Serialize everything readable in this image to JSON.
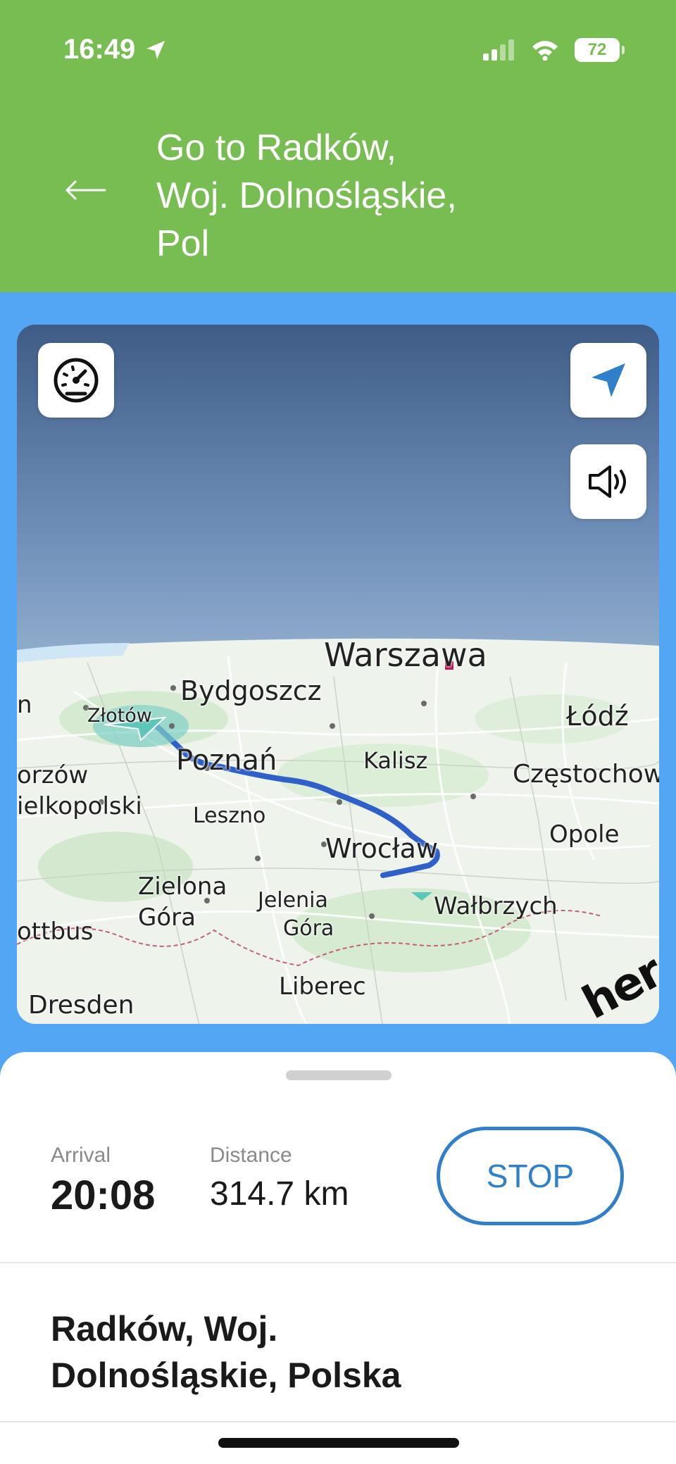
{
  "status_bar": {
    "time": "16:49",
    "battery": "72"
  },
  "header": {
    "title_lines": [
      "Go to Radków,",
      "Woj. Dolnośląskie,",
      "Pol"
    ]
  },
  "map": {
    "labels": {
      "warszawa": "Warszawa",
      "bydgoszcz": "Bydgoszcz",
      "zlotow": "Złotów",
      "lodz": "Łódź",
      "poznan": "Poznań",
      "kalisz": "Kalisz",
      "czestochowa": "Częstochow",
      "gorzow": "orzów",
      "wielkopolski": "ielkopolski",
      "leszno": "Leszno",
      "opole": "Opole",
      "wroclaw": "Wrocław",
      "zielona_line1": "Zielona",
      "zielona_line2": "Góra",
      "jelenia_line1": "Jelenia",
      "jelenia_line2": "Góra",
      "walbrzych": "Wałbrzych",
      "cottbus": "ottbus",
      "liberec": "Liberec",
      "dresden": "Dresden",
      "edge_n": "n"
    },
    "logo": "here",
    "colors": {
      "route": "#2f5fc8",
      "capital_marker": "#c2185b",
      "land": "#eef3ec",
      "sky_top": "#3e5c86"
    }
  },
  "trip": {
    "arrival_label": "Arrival",
    "arrival_value": "20:08",
    "distance_label": "Distance",
    "distance_value": "314.7 km",
    "stop_label": "STOP"
  },
  "destination": {
    "lines": [
      "Radków, Woj.",
      "Dolnośląskie, Polska"
    ]
  },
  "icons": [
    "location-arrow-icon",
    "signal-icon",
    "wifi-icon",
    "battery-icon",
    "back-arrow-icon",
    "speedometer-icon",
    "navigation-arrow-icon",
    "speaker-icon"
  ]
}
